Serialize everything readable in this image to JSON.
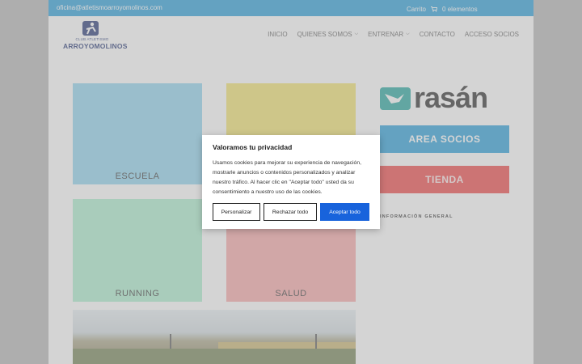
{
  "topbar": {
    "email": "oficina@atletismoarroyomolinos.com",
    "cart_label": "Carrito",
    "cart_count": "0 elementos"
  },
  "logo": {
    "club": "CLUB ATLETISMO",
    "name": "ARROYOMOLINOS"
  },
  "nav": {
    "items": [
      {
        "label": "INICIO",
        "dropdown": false
      },
      {
        "label": "QUIENES SOMOS",
        "dropdown": true
      },
      {
        "label": "ENTRENAR",
        "dropdown": true
      },
      {
        "label": "CONTACTO",
        "dropdown": false
      },
      {
        "label": "ACCESO SOCIOS",
        "dropdown": false
      }
    ]
  },
  "tiles": [
    {
      "label": "ESCUELA",
      "color": "#8ad3ee"
    },
    {
      "label": "",
      "color": "#f2e268"
    },
    {
      "label": "RUNNING",
      "color": "#a8efcd"
    },
    {
      "label": "SALUD",
      "color": "#f8a5a5"
    }
  ],
  "sidebar": {
    "brand": "rasán",
    "area_socios": "AREA SOCIOS",
    "tienda": "TIENDA",
    "info": "INFORMACIÓN GENERAL"
  },
  "cookie": {
    "title": "Valoramos tu privacidad",
    "text": "Usamos cookies para mejorar su experiencia de navegación, mostrarle anuncios o contenidos personalizados y analizar nuestro tráfico. Al hacer clic en \"Aceptar todo\" usted da su consentimiento a nuestro uso de las cookies.",
    "customize": "Personalizar",
    "reject": "Rechazar todo",
    "accept": "Aceptar todo"
  },
  "colors": {
    "accent": "#1f9ad9",
    "cookie_blue": "#1863dc",
    "shop_red": "#ef3e3e"
  }
}
